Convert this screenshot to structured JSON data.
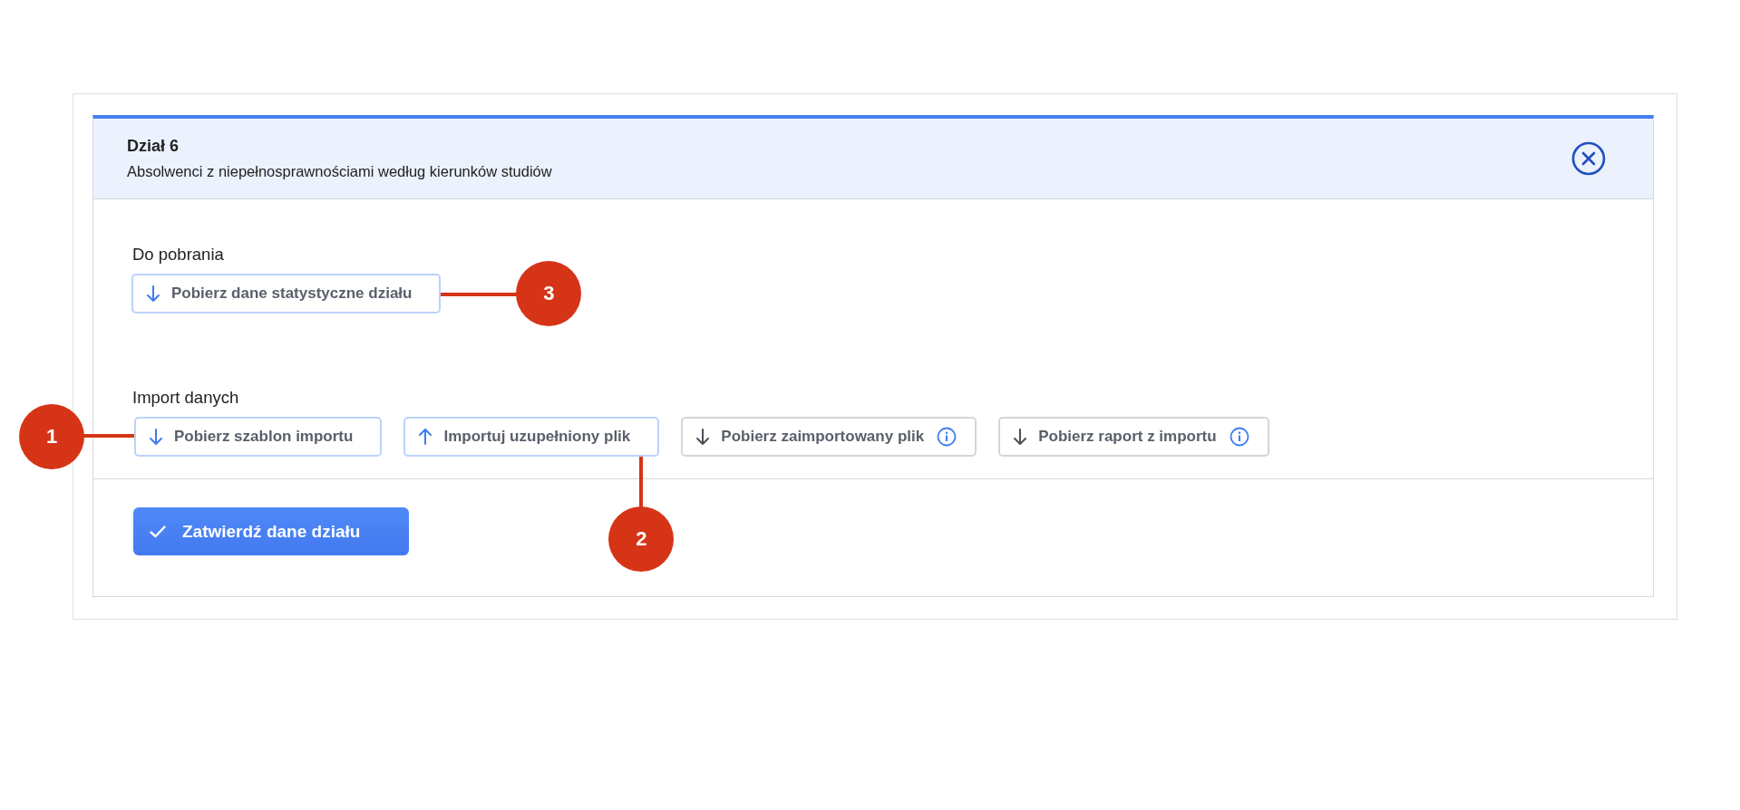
{
  "panel": {
    "title": "Dział 6",
    "subtitle": "Absolwenci z niepełnosprawnościami według kierunków studiów"
  },
  "sections": [
    {
      "heading": "Do pobrania",
      "buttons": [
        {
          "label": "Pobierz dane statystyczne działu",
          "kind": "download",
          "disabled": false,
          "info": false,
          "callout": {
            "label": "3",
            "kind": "right"
          }
        }
      ]
    },
    {
      "heading": "Import danych",
      "buttons": [
        {
          "label": "Pobierz szablon importu",
          "kind": "download",
          "disabled": false,
          "info": false,
          "callout": {
            "label": "1",
            "kind": "left"
          }
        },
        {
          "label": "Importuj uzupełniony plik",
          "kind": "upload",
          "disabled": false,
          "info": false,
          "callout": {
            "label": "2",
            "kind": "bottom"
          }
        },
        {
          "label": "Pobierz zaimportowany plik",
          "kind": "download",
          "disabled": true,
          "info": true
        },
        {
          "label": "Pobierz raport z importu",
          "kind": "download",
          "disabled": true,
          "info": true
        }
      ]
    }
  ],
  "submit": {
    "label": "Zatwierdź dane działu"
  }
}
